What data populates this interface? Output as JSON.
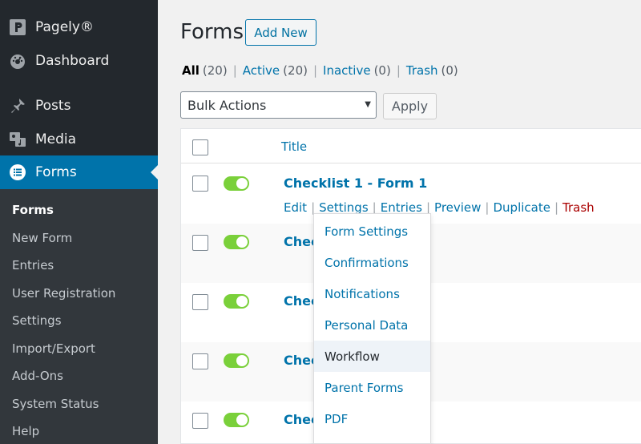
{
  "sidebar": {
    "top_items": [
      {
        "label": "Pagely®",
        "icon": "pagely-logo-icon"
      },
      {
        "label": "Dashboard",
        "icon": "dashboard-icon"
      },
      {
        "label": "Posts",
        "icon": "pushpin-icon"
      },
      {
        "label": "Media",
        "icon": "media-icon"
      },
      {
        "label": "Forms",
        "icon": "forms-icon",
        "active": true
      }
    ],
    "submenu": [
      {
        "label": "Forms",
        "current": true
      },
      {
        "label": "New Form"
      },
      {
        "label": "Entries"
      },
      {
        "label": "User Registration"
      },
      {
        "label": "Settings"
      },
      {
        "label": "Import/Export"
      },
      {
        "label": "Add-Ons"
      },
      {
        "label": "System Status"
      },
      {
        "label": "Help"
      }
    ]
  },
  "page": {
    "title": "Forms",
    "add_new_label": "Add New"
  },
  "filters": {
    "all": {
      "label": "All",
      "count": "(20)"
    },
    "active": {
      "label": "Active",
      "count": "(20)"
    },
    "inactive": {
      "label": "Inactive",
      "count": "(0)"
    },
    "trash": {
      "label": "Trash",
      "count": "(0)"
    }
  },
  "bulk": {
    "selected": "Bulk Actions",
    "apply_label": "Apply"
  },
  "table": {
    "header_title": "Title",
    "rows": [
      {
        "title": "Checklist 1 - Form 1",
        "active": true
      },
      {
        "title": "Chec",
        "active": true
      },
      {
        "title": "Chec",
        "active": true
      },
      {
        "title": "Chec",
        "active": true
      },
      {
        "title": "Chec",
        "active": true
      }
    ],
    "row_actions": {
      "edit": "Edit",
      "settings": "Settings",
      "entries": "Entries",
      "preview": "Preview",
      "duplicate": "Duplicate",
      "trash": "Trash"
    }
  },
  "settings_dropdown": {
    "items": [
      "Form Settings",
      "Confirmations",
      "Notifications",
      "Personal Data",
      "Workflow",
      "Parent Forms",
      "PDF"
    ],
    "hovered": "Workflow"
  },
  "colors": {
    "sidebar_bg": "#23282d",
    "submenu_bg": "#32373c",
    "accent": "#0073aa",
    "toggle_on": "#7ad03a",
    "trash": "#aa0000"
  }
}
